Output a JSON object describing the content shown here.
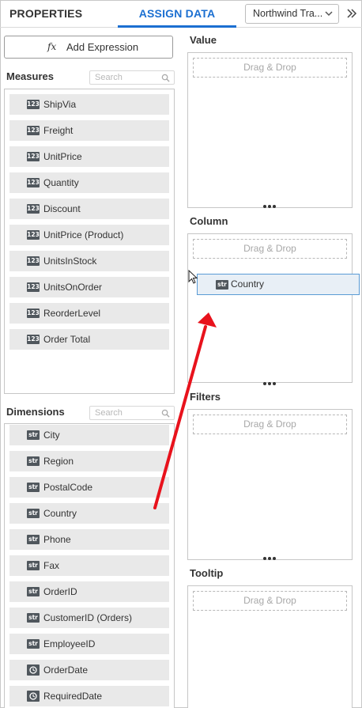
{
  "header": {
    "tabs": [
      {
        "label": "PROPERTIES"
      },
      {
        "label": "ASSIGN DATA"
      }
    ],
    "datasource": "Northwind Tra..."
  },
  "left": {
    "add_expression": {
      "icon": "fx",
      "label": "Add Expression"
    },
    "measures": {
      "title": "Measures",
      "search_placeholder": "Search",
      "items": [
        {
          "type": "123",
          "name": "ShipVia"
        },
        {
          "type": "123",
          "name": "Freight"
        },
        {
          "type": "123",
          "name": "UnitPrice"
        },
        {
          "type": "123",
          "name": "Quantity"
        },
        {
          "type": "123",
          "name": "Discount"
        },
        {
          "type": "123",
          "name": "UnitPrice (Product)"
        },
        {
          "type": "123",
          "name": "UnitsInStock"
        },
        {
          "type": "123",
          "name": "UnitsOnOrder"
        },
        {
          "type": "123",
          "name": "ReorderLevel"
        },
        {
          "type": "123",
          "name": "Order Total"
        }
      ]
    },
    "dimensions": {
      "title": "Dimensions",
      "search_placeholder": "Search",
      "items": [
        {
          "type": "str",
          "name": "City"
        },
        {
          "type": "str",
          "name": "Region"
        },
        {
          "type": "str",
          "name": "PostalCode"
        },
        {
          "type": "str",
          "name": "Country"
        },
        {
          "type": "str",
          "name": "Phone"
        },
        {
          "type": "str",
          "name": "Fax"
        },
        {
          "type": "str",
          "name": "OrderID"
        },
        {
          "type": "str",
          "name": "CustomerID (Orders)"
        },
        {
          "type": "str",
          "name": "EmployeeID"
        },
        {
          "type": "date",
          "name": "OrderDate"
        },
        {
          "type": "date",
          "name": "RequiredDate"
        }
      ]
    }
  },
  "right": {
    "sections": [
      {
        "title": "Value",
        "drop_text": "Drag & Drop"
      },
      {
        "title": "Column",
        "drop_text": "Drag & Drop"
      },
      {
        "title": "Filters",
        "drop_text": "Drag & Drop"
      },
      {
        "title": "Tooltip",
        "drop_text": "Drag & Drop"
      }
    ]
  },
  "drag": {
    "type": "str",
    "name": "Country"
  },
  "colors": {
    "accent": "#1b6fd1",
    "annotation_arrow": "#e8121c",
    "drag_border": "#5a9bd5"
  }
}
